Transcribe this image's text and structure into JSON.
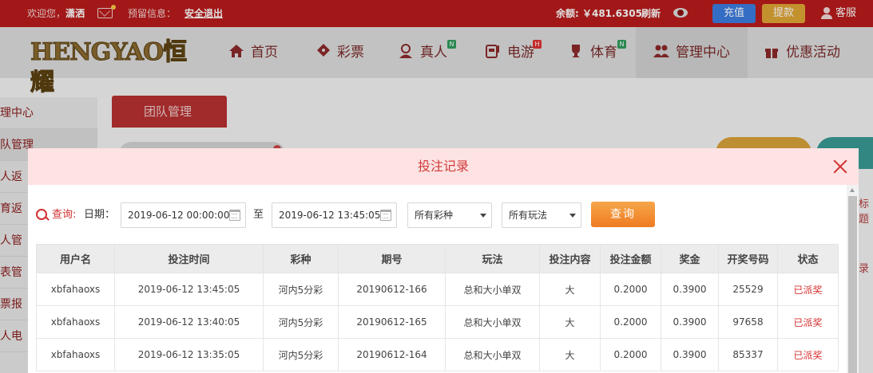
{
  "topbar": {
    "welcome": "欢迎您，",
    "username": "潇洒",
    "preview_label": "预留信息：",
    "logout": "安全退出",
    "balance_label": "余额: ￥481.6305",
    "refresh": "刷新",
    "recharge": "充值",
    "withdraw": "提款",
    "service": "客服",
    "colors": {
      "bar": "#b91c1c",
      "recharge": "#3c7de0",
      "withdraw": "#e0a536"
    }
  },
  "nav": {
    "logo": "HENGYAO恒耀",
    "items": [
      {
        "label": "首页",
        "icon": "home-icon",
        "badge": ""
      },
      {
        "label": "彩票",
        "icon": "ticket-icon",
        "badge": ""
      },
      {
        "label": "真人",
        "icon": "person-icon",
        "badge": "N"
      },
      {
        "label": "电游",
        "icon": "slot-machine-icon",
        "badge": "H"
      },
      {
        "label": "体育",
        "icon": "trophy-icon",
        "badge": "N"
      },
      {
        "label": "管理中心",
        "icon": "users-icon",
        "badge": ""
      },
      {
        "label": "优惠活动",
        "icon": "gift-icon",
        "badge": ""
      }
    ]
  },
  "sidebar": {
    "items": [
      "管理中心",
      "团队管理",
      "真人返",
      "体育返",
      "个人管",
      "报表管",
      "彩票报",
      "真人电"
    ]
  },
  "main": {
    "tab": "团队管理",
    "right_fragments": [
      "标题",
      "录"
    ]
  },
  "modal": {
    "title": "投注记录",
    "query_label": "查询:",
    "date_label": "日期：",
    "date_start": "2019-06-12 00:00:00",
    "to_label": "至",
    "date_end": "2019-06-12 13:45:05",
    "lottery_select": "所有彩种",
    "play_select": "所有玩法",
    "search_button": "查询",
    "columns": [
      "用户名",
      "投注时间",
      "彩种",
      "期号",
      "玩法",
      "投注内容",
      "投注金额",
      "奖金",
      "开奖号码",
      "状态"
    ],
    "rows": [
      [
        "xbfahaoxs",
        "2019-06-12 13:45:05",
        "河内5分彩",
        "20190612-166",
        "总和大小单双",
        "大",
        "0.2000",
        "0.3900",
        "25529",
        "已派奖"
      ],
      [
        "xbfahaoxs",
        "2019-06-12 13:40:05",
        "河内5分彩",
        "20190612-165",
        "总和大小单双",
        "大",
        "0.2000",
        "0.3900",
        "97658",
        "已派奖"
      ],
      [
        "xbfahaoxs",
        "2019-06-12 13:35:05",
        "河内5分彩",
        "20190612-164",
        "总和大小单双",
        "大",
        "0.2000",
        "0.3900",
        "85337",
        "已派奖"
      ]
    ]
  }
}
